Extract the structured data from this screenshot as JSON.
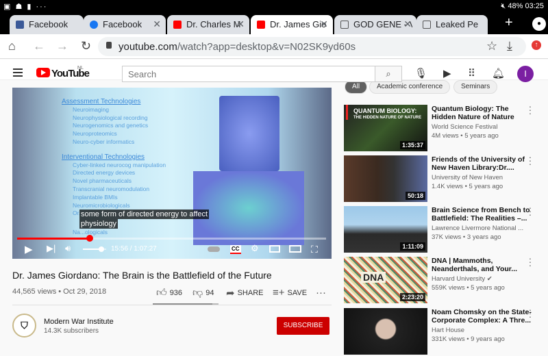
{
  "status_bar": {
    "left_icons": "▣ ☗ ▮ ···",
    "battery": "48%",
    "time": "03:25"
  },
  "browser": {
    "tabs": [
      {
        "title": "Facebook",
        "icon": "facebook-icon",
        "color": "#3b5998"
      },
      {
        "title": "Facebook",
        "icon": "facebook-icon",
        "color": "#1877f2"
      },
      {
        "title": "Dr. Charles M",
        "icon": "youtube-icon",
        "color": "#ff0000"
      },
      {
        "title": "Dr. James Gio",
        "icon": "youtube-icon",
        "color": "#ff0000"
      },
      {
        "title": "GOD GENE - V",
        "icon": "document-icon",
        "color": "#ffffff"
      },
      {
        "title": "Leaked Pe",
        "icon": "document-icon",
        "color": "#ffffff"
      }
    ],
    "active_tab": 3,
    "url_domain": "youtube.com",
    "url_rest": "/watch?app=desktop&v=N02SK9yd60s"
  },
  "youtube": {
    "logo": "YouTube",
    "region": "NL",
    "search_placeholder": "Search",
    "avatar_letter": "I",
    "chips": [
      "All",
      "Academic conference",
      "Seminars"
    ]
  },
  "player": {
    "slide": {
      "heading1": "Assessment Technologies",
      "items1": [
        "Neuroimaging",
        "Neurophysiological recording",
        "Neurogenomics and genetics",
        "Neuroproteomics",
        "Neuro-cyber informatics"
      ],
      "heading2": "Interventional Technologies",
      "items2": [
        "Cyber-linked neurocog manipulation",
        "Directed energy devices",
        "Novel pharmaceuticals",
        "Transcranial neuromodulation",
        "Implantable BMIs",
        "Neuromicrobiologicals",
        "Or...",
        "Na...ologicals"
      ]
    },
    "caption_line1": "some form of directed energy to affect",
    "caption_line2": "physiology",
    "time": "15:56 / 1:07:27",
    "progress_fraction": 0.236,
    "volume_fraction": 0.8,
    "cc_label": "CC"
  },
  "video": {
    "title": "Dr. James Giordano: The Brain is the Battlefield of the Future",
    "meta": "44,565 views • Oct 29, 2018",
    "likes": "936",
    "dislikes": "94",
    "share": "SHARE",
    "save": "SAVE",
    "like_ratio": 0.91,
    "channel": "Modern War Institute",
    "subscribers": "14.3K subscribers",
    "subscribe": "SUBSCRIBE"
  },
  "recommendations": [
    {
      "title": "Quantum Biology: The Hidden Nature of Nature",
      "channel": "World Science Festival",
      "views": "4M views • 5 years ago",
      "duration": "1:35:37",
      "thumb_text1": "QUANTUM BIOLOGY:",
      "thumb_text2": "THE HIDDEN NATURE OF NATURE"
    },
    {
      "title": "Friends of the University of New Haven Library:Dr....",
      "channel": "University of New Haven",
      "views": "1.4K views • 5 years ago",
      "duration": "50:18"
    },
    {
      "title": "Brain Science from Bench to Battlefield: The Realities –...",
      "channel": "Lawrence Livermore National ...",
      "views": "37K views • 3 years ago",
      "duration": "1:11:09"
    },
    {
      "title": "DNA | Mammoths, Neanderthals, and Your...",
      "channel": "Harvard University ✔",
      "views": "559K views • 5 years ago",
      "duration": "2:23:20",
      "thumb_text1": "DNA"
    },
    {
      "title": "Noam Chomsky on the State-Corporate Complex: A Thre...",
      "channel": "Hart House",
      "views": "331K views • 9 years ago",
      "duration": ""
    }
  ]
}
